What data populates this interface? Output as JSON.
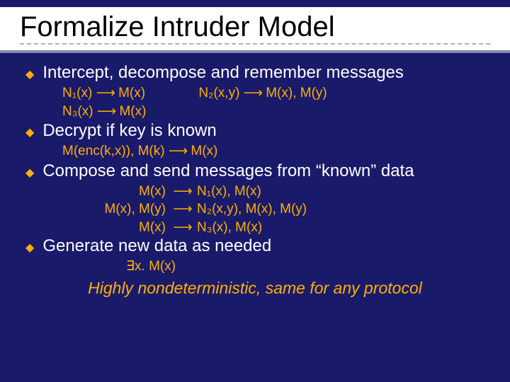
{
  "title": "Formalize Intruder Model",
  "bullets": [
    {
      "text": "Intercept, decompose and remember messages",
      "lines": [
        {
          "lhs": "N₁(x)",
          "arr": "⟶",
          "rhs": "M(x)",
          "col2_lhs": "N₂(x,y)",
          "col2_arr": "⟶",
          "col2_rhs": "M(x), M(y)"
        },
        {
          "lhs": "N₃(x)",
          "arr": "⟶",
          "rhs": "M(x)"
        }
      ]
    },
    {
      "text": "Decrypt if key is known",
      "lines": [
        {
          "lhs": "M(enc(k,x)), M(k)",
          "arr": "⟶",
          "rhs": "M(x)"
        }
      ]
    },
    {
      "text": "Compose and send messages from “known” data",
      "grid": [
        {
          "lhs": "M(x)",
          "arr": "⟶",
          "rhs": "N₁(x), M(x)"
        },
        {
          "lhs": "M(x), M(y)",
          "arr": "⟶",
          "rhs": "N₂(x,y), M(x), M(y)"
        },
        {
          "lhs": "M(x)",
          "arr": "⟶",
          "rhs": "N₃(x), M(x)"
        }
      ]
    },
    {
      "text": "Generate new data as needed",
      "lines": [
        {
          "plain": "∃x. M(x)"
        }
      ]
    }
  ],
  "footer": "Highly nondeterministic, same for any protocol"
}
